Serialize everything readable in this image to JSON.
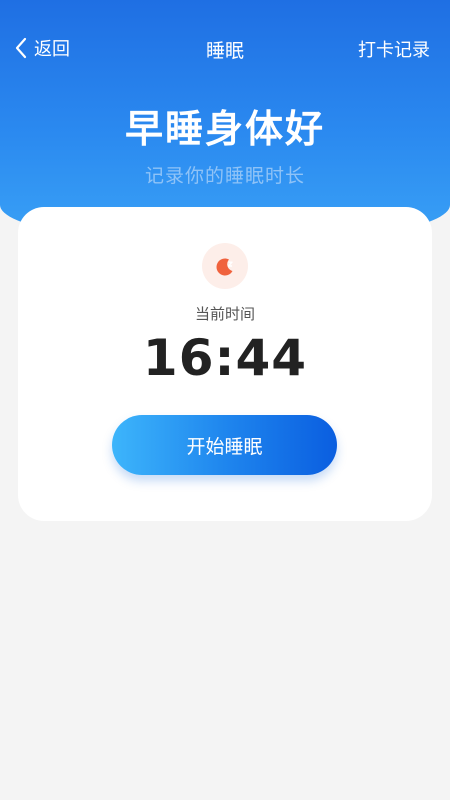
{
  "navbar": {
    "back_label": "返回",
    "title": "睡眠",
    "right_label": "打卡记录"
  },
  "hero": {
    "title": "早睡身体好",
    "subtitle": "记录你的睡眠时长"
  },
  "card": {
    "icon": "moon-sleep-icon",
    "time_label": "当前时间",
    "time_value": "16:44",
    "button_label": "开始睡眠"
  },
  "colors": {
    "primary": "#1f6fe3",
    "button_start": "#3db5fb",
    "button_end": "#0a5ee0",
    "icon_accent": "#f0623d",
    "background": "#f4f4f4"
  }
}
